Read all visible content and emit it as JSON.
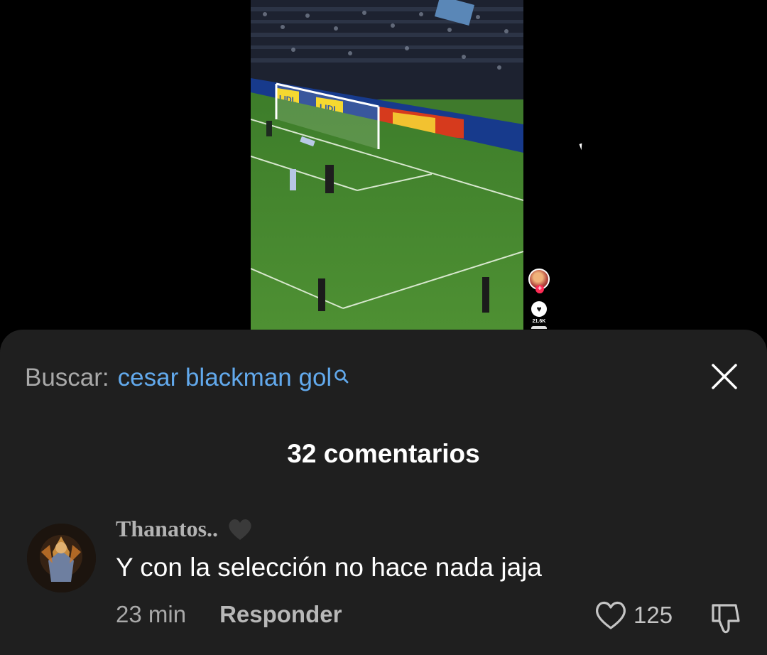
{
  "video": {
    "ad_board_text": "LIDL",
    "like_count": "21.6K"
  },
  "sheet": {
    "search_label": "Buscar:",
    "search_query": "cesar blackman gol",
    "comment_count_title": "32 comentarios"
  },
  "comment": {
    "author": "Thanatos..",
    "text": "Y con la selección no hace nada jaja",
    "time": "23 min",
    "reply_label": "Responder",
    "likes": "125"
  },
  "colors": {
    "sheet_background": "#1f1f1f",
    "search_link": "#62a9ec",
    "pitch_green": "#4f8f35"
  }
}
